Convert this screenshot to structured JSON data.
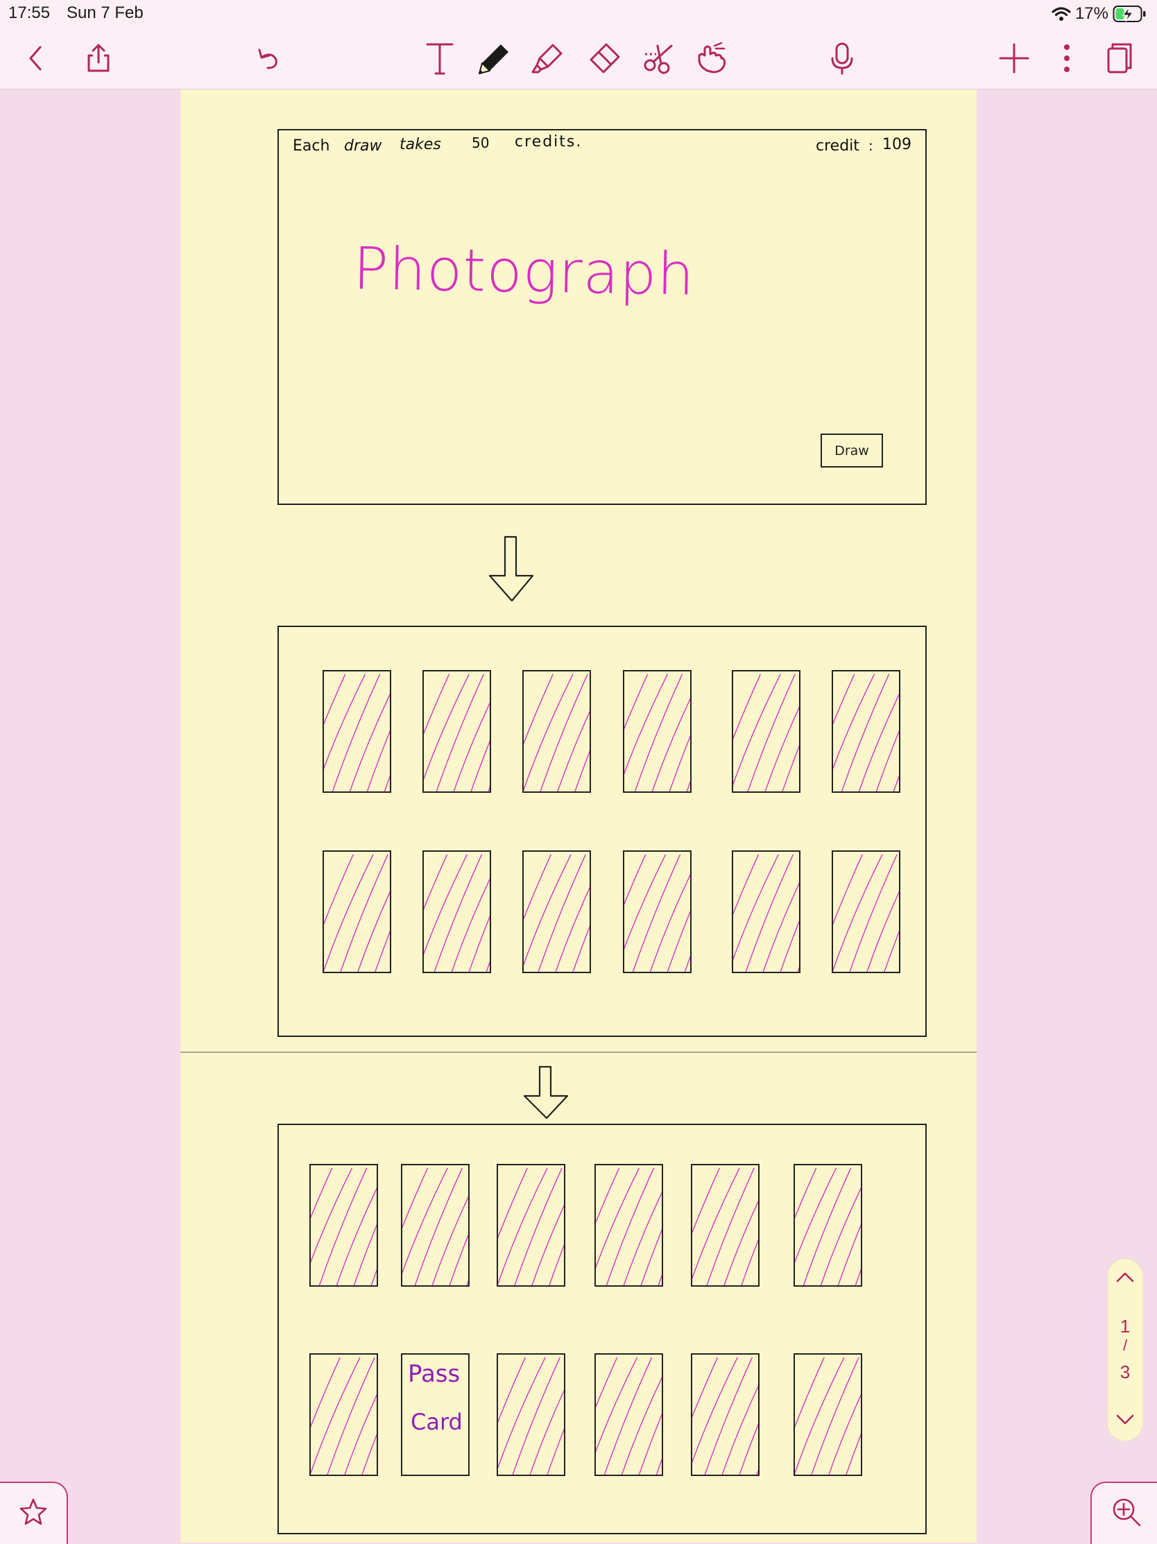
{
  "status_bar": {
    "time": "17:55",
    "date": "Sun 7 Feb",
    "battery": "17%"
  },
  "toolbar": {
    "icons": [
      "back-chevron-icon",
      "share-icon",
      "undo-icon",
      "text-tool-icon",
      "pen-icon",
      "highlighter-icon",
      "eraser-icon",
      "lasso-scissors-icon",
      "hand-pointer-icon",
      "microphone-icon",
      "add-icon",
      "more-vertical-icon",
      "pages-icon"
    ],
    "accent_color": "#b2265e"
  },
  "sketch": {
    "screen1": {
      "cost_text": [
        "Each",
        "draw",
        "takes",
        "50",
        "credits."
      ],
      "credit_label": "credit",
      "credit_colon": ":",
      "credit_value": "109",
      "headline": "Photograph",
      "draw_button": "Draw"
    },
    "screen2": {
      "card_rows": 2,
      "cards_per_row": 6
    },
    "screen3": {
      "card_rows": 2,
      "cards_per_row": 6,
      "pass_card_line1": "Pass",
      "pass_card_line2": "Card"
    },
    "ink_color": "#d72fc4",
    "pass_card_color": "#8d1fb8"
  },
  "page_nav": {
    "current": "1",
    "separator": "/",
    "total": "3"
  },
  "bottom": {
    "favorite_icon": "star-icon",
    "zoom_icon": "zoom-in-icon"
  }
}
